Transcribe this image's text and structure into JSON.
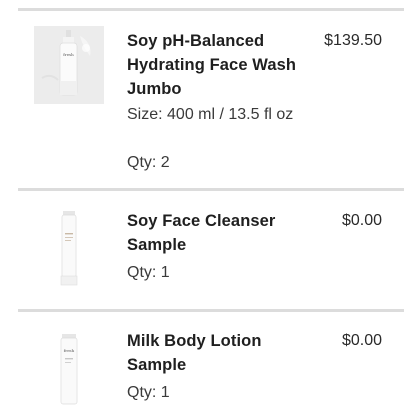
{
  "cart": {
    "items": [
      {
        "name": "Soy pH-Balanced Hydrating Face Wash Jumbo",
        "size": "Size: 400 ml / 13.5 fl oz",
        "qty": "Qty: 2",
        "price": "$139.50",
        "image": "face-wash-bottle-icon",
        "brand_mark": "fresh"
      },
      {
        "name": "Soy Face Cleanser Sample",
        "qty": "Qty: 1",
        "price": "$0.00",
        "image": "cleanser-tube-icon"
      },
      {
        "name": "Milk Body Lotion Sample",
        "qty": "Qty: 1",
        "price": "$0.00",
        "image": "lotion-tube-icon",
        "brand_mark": "fresh"
      }
    ]
  }
}
